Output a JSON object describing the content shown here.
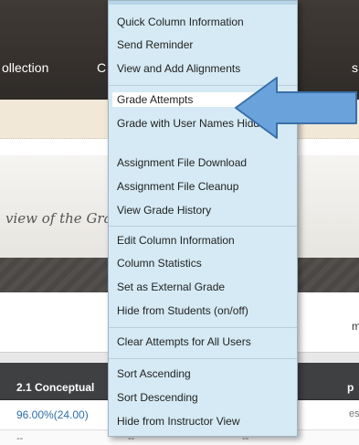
{
  "background": {
    "nav_items": [
      "ollection",
      "C"
    ],
    "nav_cut_right": "s",
    "banner_text": "view of the Grad",
    "side_cut_text": "m",
    "table": {
      "header_label": "2.1 Conceptual",
      "header_cut_right": "p",
      "row1_score": "96.00%(24.00)",
      "row1_cut_right": "es",
      "row2_cells": [
        "--",
        "--",
        "--"
      ]
    }
  },
  "menu": {
    "group1": [
      "Quick Column Information",
      "Send Reminder",
      "View and Add Alignments"
    ],
    "group2": [
      "Grade Attempts",
      "Grade with User Names Hidden",
      "Assignment File Download",
      "Assignment File Cleanup",
      "View Grade History"
    ],
    "group3": [
      "Edit Column Information",
      "Column Statistics",
      "Set as External Grade",
      "Hide from Students (on/off)"
    ],
    "group4": [
      "Clear Attempts for All Users"
    ],
    "group5": [
      "Sort Ascending",
      "Sort Descending",
      "Hide from Instructor View"
    ],
    "highlighted_item": "Grade Attempts"
  },
  "colors": {
    "menu_bg": "#d5eaf4",
    "highlight_bg": "#ffffff",
    "arrow_fill": "#6aa3dc",
    "arrow_stroke": "#3a6fa8",
    "table_header": "#3f4042",
    "nav_dark": "#3f3a36",
    "link_blue": "#2b6ea8"
  },
  "icons": {
    "callout": "arrow-left-icon"
  }
}
